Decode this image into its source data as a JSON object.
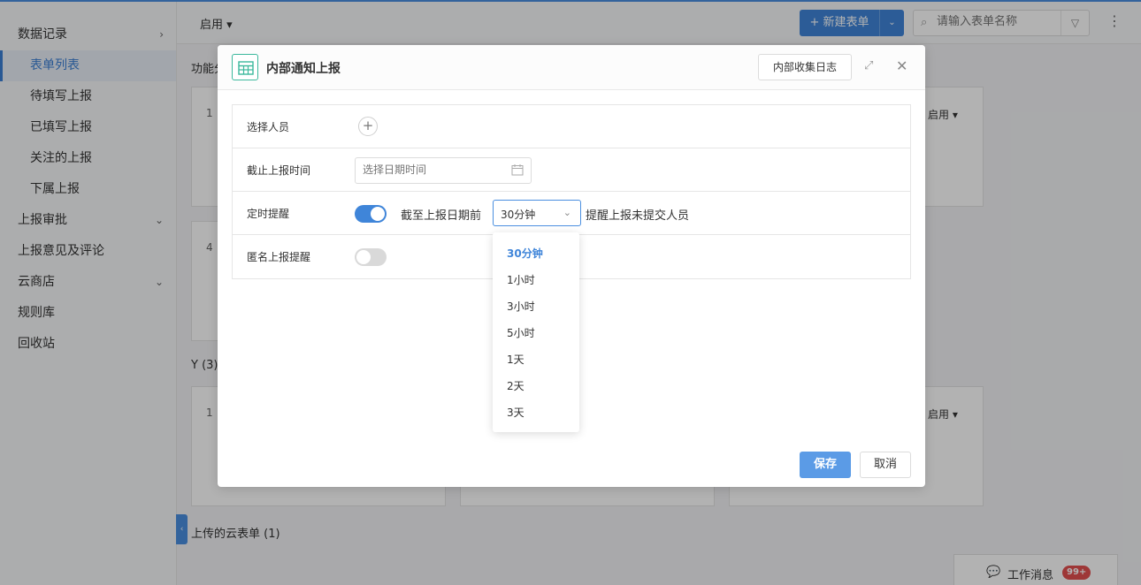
{
  "sidebar": {
    "items": [
      {
        "label": "数据记录",
        "chevron": "›"
      },
      {
        "label": "表单列表"
      },
      {
        "label": "待填写上报"
      },
      {
        "label": "已填写上报"
      },
      {
        "label": "关注的上报"
      },
      {
        "label": "下属上报"
      },
      {
        "label": "上报审批",
        "chevron": "⌄"
      },
      {
        "label": "上报意见及评论"
      },
      {
        "label": "云商店",
        "chevron": "⌄"
      },
      {
        "label": "规则库"
      },
      {
        "label": "回收站"
      }
    ]
  },
  "topbar": {
    "status_filter": "启用 ▾",
    "new_form": "+ 新建表单",
    "new_form_arrow": "⌄",
    "search_placeholder": "请输入表单名称",
    "search_icon": "⌕",
    "filter_icon": "▽",
    "more_icon": "⋮"
  },
  "background": {
    "section_1": "功能分",
    "section_2": "Y (3)",
    "section_3": "上传的云表单 (1)",
    "card_nums": [
      "1",
      "4",
      "1"
    ],
    "card_status": "启用 ▾",
    "collapse_icon": "‹"
  },
  "messages": {
    "icon": "💬",
    "label": "工作消息",
    "badge": "99+"
  },
  "modal": {
    "title": "内部通知上报",
    "log_button": "内部收集日志",
    "expand_icon": "⤢",
    "close_icon": "✕",
    "rows": {
      "select_person": {
        "label": "选择人员",
        "add_icon": "+"
      },
      "deadline": {
        "label": "截止上报时间",
        "placeholder": "选择日期时间"
      },
      "timed_reminder": {
        "label": "定时提醒",
        "enabled": true,
        "prefix": "截至上报日期前",
        "selected": "30分钟",
        "arrow": "⌄",
        "suffix": "提醒上报未提交人员"
      },
      "anonymous": {
        "label": "匿名上报提醒",
        "enabled": false
      }
    },
    "save": "保存",
    "cancel": "取消"
  },
  "dropdown": {
    "options": [
      "30分钟",
      "1小时",
      "3小时",
      "5小时",
      "1天",
      "2天",
      "3天"
    ],
    "selected_index": 0
  },
  "colors": {
    "accent": "#3f85d9",
    "form_icon": "#3bb89c",
    "badge": "#e25050"
  }
}
